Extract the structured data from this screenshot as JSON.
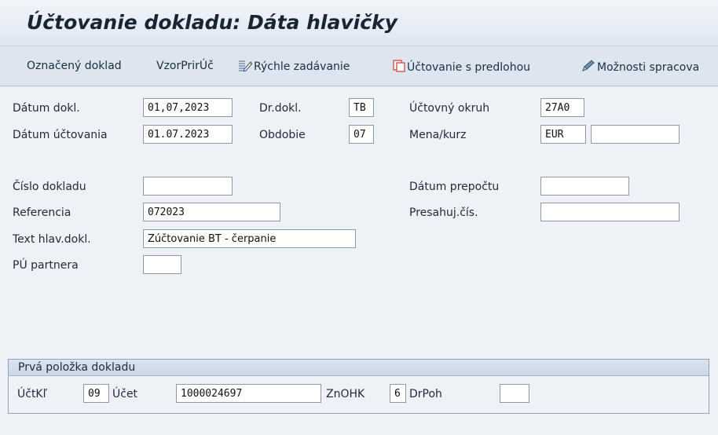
{
  "header": {
    "title": "Účtovanie dokladu: Dáta hlavičky"
  },
  "toolbar": {
    "items": [
      {
        "label": "Označený doklad",
        "icon": ""
      },
      {
        "label": "VzorPrirÚč",
        "icon": ""
      },
      {
        "label": "Rýchle zadávanie",
        "icon": "fast-entry-icon"
      },
      {
        "label": "Účtovanie s predlohou",
        "icon": "copy-template-icon"
      },
      {
        "label": "Možnosti spracova",
        "icon": "pencil-icon"
      }
    ]
  },
  "form": {
    "doc_date": {
      "label": "Dátum dokl.",
      "value": "01,07,2023"
    },
    "posting_date": {
      "label": "Dátum účtovania",
      "value": "01.07.2023"
    },
    "doc_type": {
      "label": "Dr.dokl.",
      "value": "TB"
    },
    "period": {
      "label": "Obdobie",
      "value": "07"
    },
    "company_code": {
      "label": "Účtovný okruh",
      "value": "27A0"
    },
    "currency": {
      "label": "Mena/kurz",
      "value": "EUR",
      "rate": ""
    },
    "doc_number": {
      "label": "Číslo dokladu",
      "value": ""
    },
    "translation_date": {
      "label": "Dátum prepočtu",
      "value": ""
    },
    "reference": {
      "label": "Referencia",
      "value": "072023"
    },
    "cross_cc": {
      "label": "Presahuj.čís.",
      "value": ""
    },
    "header_text": {
      "label": "Text hlav.dokl.",
      "value": "Zúčtovanie BT - čerpanie"
    },
    "partner": {
      "label": "PÚ partnera",
      "value": ""
    }
  },
  "first_item": {
    "title": "Prvá položka dokladu",
    "posting_key": {
      "label": "ÚčtKľ",
      "value": "09"
    },
    "account": {
      "label": "Účet",
      "value": "1000024697"
    },
    "special_gl": {
      "label": "ZnOHK",
      "value": "6"
    },
    "trans_type": {
      "label": "DrPoh",
      "value": ""
    }
  },
  "colors": {
    "title_bg": "#e8edf4",
    "toolbar_bg": "#dde5ef",
    "field_border": "#8d99a8",
    "accent_red": "#d23a2a"
  }
}
